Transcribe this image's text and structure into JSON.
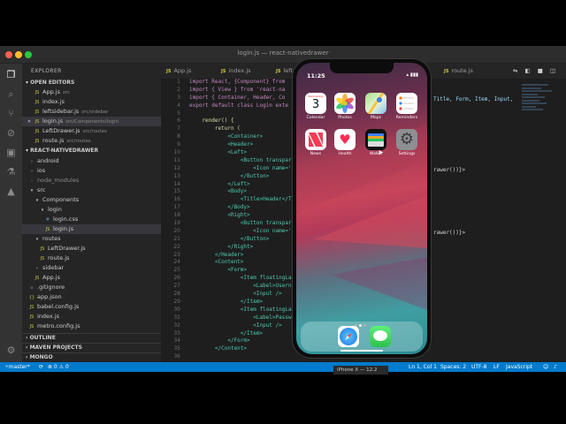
{
  "window": {
    "title": "login.js — react-nativedrawer"
  },
  "sidebar": {
    "title": "EXPLORER",
    "open_editors_header": "OPEN EDITORS",
    "open_editors": [
      {
        "name": "App.js",
        "path": "src"
      },
      {
        "name": "index.js",
        "path": ""
      },
      {
        "name": "leftsidebar.js",
        "path": "src/sidebar"
      },
      {
        "name": "login.js",
        "path": "src/Components/login",
        "close": "✕"
      },
      {
        "name": "LeftDrawer.js",
        "path": "src/routes"
      },
      {
        "name": "route.js",
        "path": "src/routes"
      }
    ],
    "project_header": "REACT-NATIVEDRAWER",
    "tree": [
      {
        "name": "android",
        "kind": "folder"
      },
      {
        "name": "ios",
        "kind": "folder"
      },
      {
        "name": "node_modules",
        "kind": "folder"
      },
      {
        "name": "src",
        "kind": "folder-open"
      },
      {
        "name": "Components",
        "kind": "folder-open"
      },
      {
        "name": "login",
        "kind": "folder-open"
      },
      {
        "name": "login.css",
        "kind": "css"
      },
      {
        "name": "login.js",
        "kind": "js"
      },
      {
        "name": "routes",
        "kind": "folder-open"
      },
      {
        "name": "LeftDrawer.js",
        "kind": "js"
      },
      {
        "name": "route.js",
        "kind": "js"
      },
      {
        "name": "sidebar",
        "kind": "folder"
      },
      {
        "name": "App.js",
        "kind": "js"
      },
      {
        "name": ".gitignore",
        "kind": "other"
      },
      {
        "name": "app.json",
        "kind": "json"
      },
      {
        "name": "babel.config.js",
        "kind": "js"
      },
      {
        "name": "index.js",
        "kind": "js"
      },
      {
        "name": "metro.config.js",
        "kind": "js"
      }
    ],
    "outline_header": "OUTLINE",
    "maven_header": "MAVEN PROJECTS",
    "mongo_header": "MONGO"
  },
  "tabs": [
    "App.js",
    "index.js",
    "left",
    "route.js"
  ],
  "editor": {
    "line_numbers": [
      "1",
      "2",
      "3",
      "4",
      "5",
      "6",
      "7",
      "8",
      "9",
      "10",
      "11",
      "12",
      "13",
      "14",
      "15",
      "16",
      "17",
      "18",
      "19",
      "20",
      "21",
      "22",
      "23",
      "24",
      "25",
      "26",
      "27",
      "28",
      "29",
      "30",
      "31",
      "32",
      "33",
      "34",
      "35",
      "36"
    ],
    "lines": [
      "import React, {Component} from",
      "import { View } from 'react-na",
      "import { Container, Header, Co",
      "export default class Login exte",
      "",
      "    render() {",
      "        return (",
      "            <Container>",
      "            <Header>",
      "            <Left>",
      "                <Button transpare",
      "                    <Icon name='men",
      "                </Button>",
      "            </Left>",
      "            <Body>",
      "                <Title>Header</Ti",
      "            </Body>",
      "            <Right>",
      "                <Button transpare",
      "                    <Icon name='me",
      "                </Button>",
      "            </Right>",
      "        </Header>",
      "        <Content>",
      "            <Form>",
      "                <Item floatingLab",
      "                    <Label>Username",
      "                    <Input />",
      "                </Item>",
      "                <Item floatingLab",
      "                    <Label>Password",
      "                    <Input />",
      "                </Item>",
      "            </Form>",
      "        </Content>",
      ""
    ],
    "right_fragments": [
      "Title, Form, Item, Input,",
      "rawer())}>",
      "rawer())}>"
    ]
  },
  "status": {
    "branch": "master*",
    "sync": "⟳",
    "problems": "⊗ 0  ⚠ 0",
    "position": "Ln 1, Col 1",
    "spaces": "Spaces: 2",
    "encoding": "UTF-8",
    "eol": "LF",
    "language": "JavaScript"
  },
  "phone": {
    "time": "11:25",
    "apps": [
      {
        "label": "Calendar",
        "day": "Wednesday",
        "date": "3"
      },
      {
        "label": "Photos"
      },
      {
        "label": "Maps"
      },
      {
        "label": "Reminders"
      },
      {
        "label": "News"
      },
      {
        "label": "Health"
      },
      {
        "label": "Wallet"
      },
      {
        "label": "Settings"
      }
    ],
    "dock": [
      "Safari",
      "Messages"
    ]
  },
  "tooltip": "iPhone X — 12.2"
}
